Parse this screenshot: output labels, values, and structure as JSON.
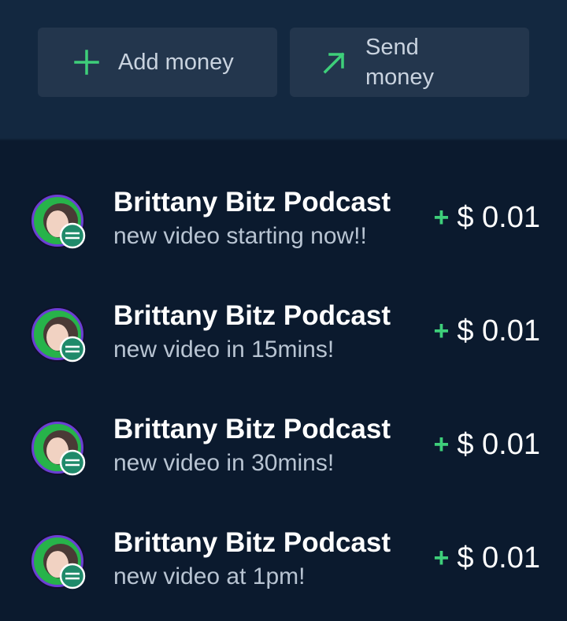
{
  "actions": {
    "add_money": {
      "label": "Add money",
      "icon": "plus-icon"
    },
    "send_money": {
      "label": "Send money",
      "icon": "arrow-up-right-icon"
    }
  },
  "colors": {
    "accent": "#3ecf7a",
    "background": "#0b1a2e",
    "header_background": "#132840",
    "button_background": "#23364d"
  },
  "transactions": [
    {
      "name": "Brittany Bitz Podcast",
      "message": "new video starting now!!",
      "sign": "+",
      "amount": "$ 0.01"
    },
    {
      "name": "Brittany Bitz Podcast",
      "message": "new video in 15mins!",
      "sign": "+",
      "amount": "$ 0.01"
    },
    {
      "name": "Brittany Bitz Podcast",
      "message": "new video in 30mins!",
      "sign": "+",
      "amount": "$ 0.01"
    },
    {
      "name": "Brittany Bitz Podcast",
      "message": "new video at 1pm!",
      "sign": "+",
      "amount": "$ 0.01"
    }
  ]
}
